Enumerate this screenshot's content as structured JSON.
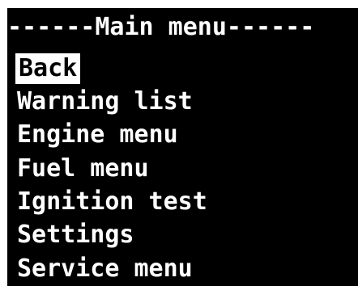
{
  "header": {
    "title": "------Main menu------"
  },
  "menu": {
    "items": [
      {
        "label": "Back",
        "selected": true
      },
      {
        "label": "Warning list",
        "selected": false
      },
      {
        "label": "Engine menu",
        "selected": false
      },
      {
        "label": "Fuel menu",
        "selected": false
      },
      {
        "label": "Ignition test",
        "selected": false
      },
      {
        "label": "Settings",
        "selected": false
      },
      {
        "label": "Service menu",
        "selected": false
      }
    ]
  },
  "colors": {
    "background": "#000000",
    "text": "#ffffff",
    "highlight_bg": "#ffffff",
    "highlight_text": "#000000"
  }
}
